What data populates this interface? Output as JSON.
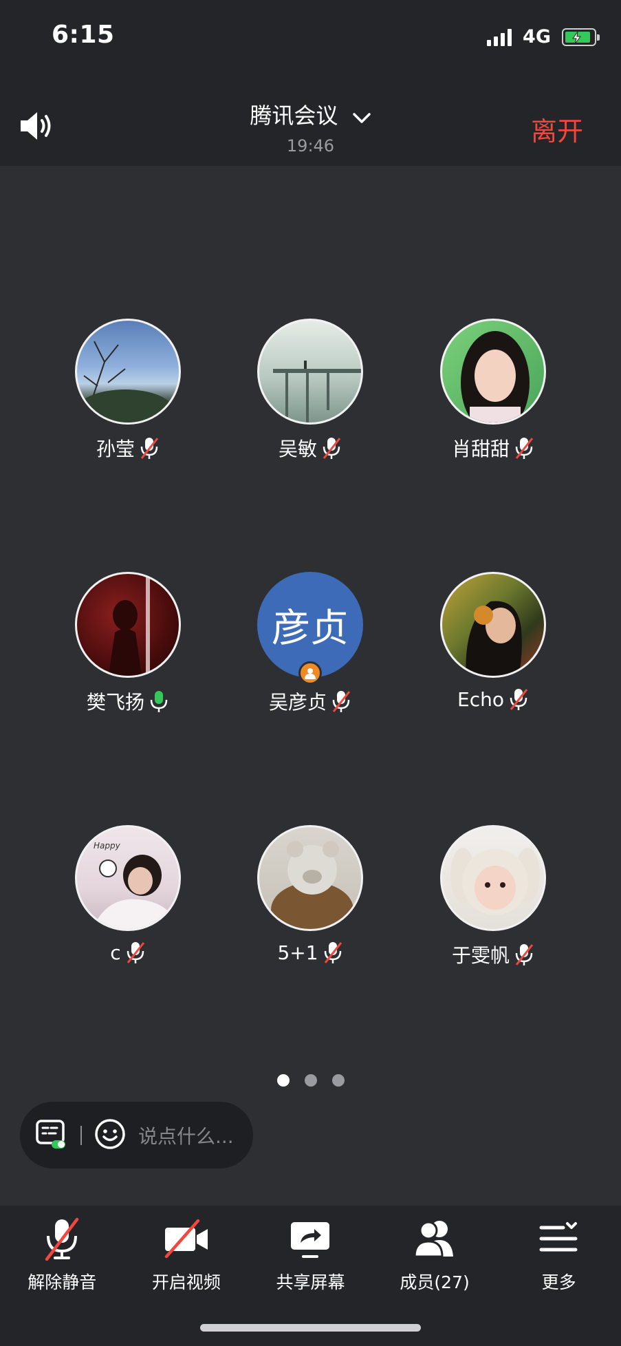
{
  "status_bar": {
    "time": "6:15",
    "network": "4G"
  },
  "header": {
    "title": "腾讯会议",
    "elapsed": "19:46",
    "leave_label": "离开"
  },
  "participants": [
    {
      "name": "孙莹",
      "mic": "muted",
      "avatar": "photo-sky-tree"
    },
    {
      "name": "吴敏",
      "mic": "muted",
      "avatar": "photo-pier-fog"
    },
    {
      "name": "肖甜甜",
      "mic": "muted",
      "avatar": "photo-woman-smiling"
    },
    {
      "name": "樊飞扬",
      "mic": "active",
      "avatar": "photo-red-stage"
    },
    {
      "name": "吴彦贞",
      "mic": "muted",
      "avatar_text": "彦贞",
      "is_host": true
    },
    {
      "name": "Echo",
      "mic": "muted",
      "avatar": "photo-girl-headphones"
    },
    {
      "name": "c",
      "mic": "muted",
      "avatar": "photo-happy-girl",
      "avatar_caption": "Happy"
    },
    {
      "name": "5+1",
      "mic": "muted",
      "avatar": "photo-teddy-bear"
    },
    {
      "name": "于雯帆",
      "mic": "muted",
      "avatar": "photo-baby-bunny-hat"
    }
  ],
  "pager": {
    "pages": 3,
    "current": 1
  },
  "chat": {
    "placeholder": "说点什么..."
  },
  "toolbar": {
    "unmute": "解除静音",
    "start_video": "开启视频",
    "share_screen": "共享屏幕",
    "members": "成员(27)",
    "more": "更多"
  },
  "colors": {
    "background": "#2e2f33",
    "bar": "#242528",
    "leave": "#f2473f",
    "mute_slash": "#f2473f",
    "mic_active": "#35c759",
    "host_avatar": "#3d6bb8",
    "host_badge": "#f08a24"
  }
}
